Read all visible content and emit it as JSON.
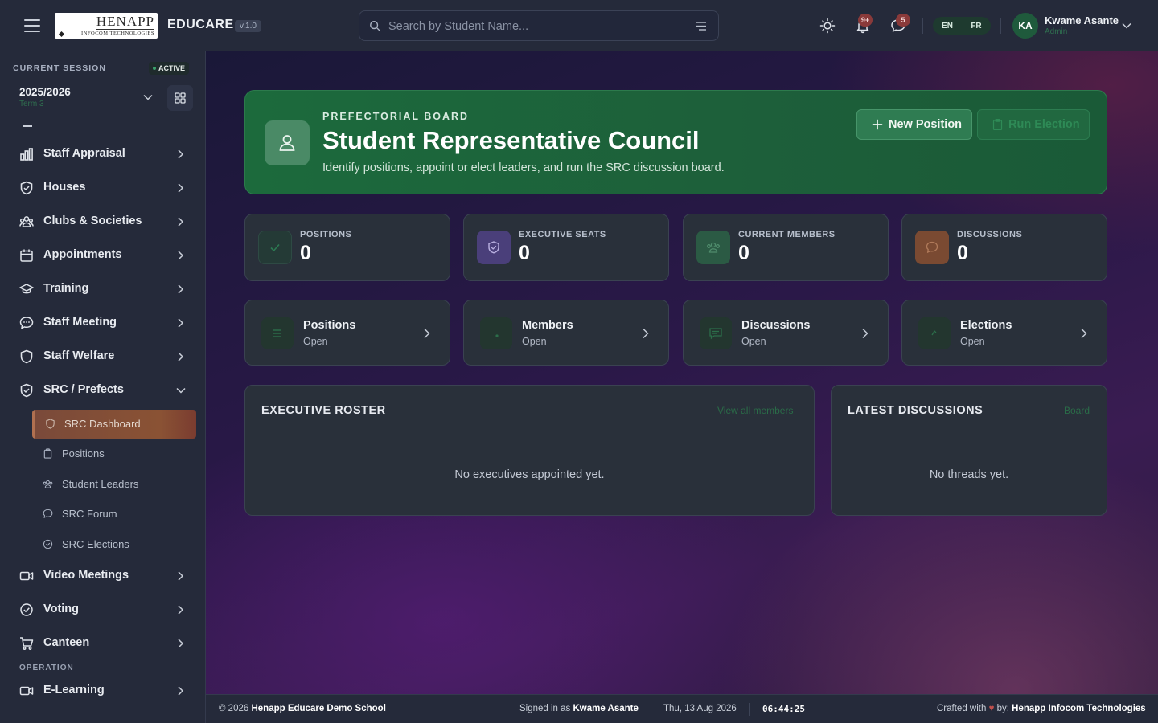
{
  "header": {
    "logo_main": "HENAPP",
    "logo_sub": "INFOCOM TECHNOLOGIES",
    "app_name": "EDUCARE",
    "version": "v.1.0",
    "search_placeholder": "Search by Student Name...",
    "notifications_badge": "9+",
    "messages_badge": "5",
    "lang_en": "EN",
    "lang_fr": "FR",
    "user_initials": "KA",
    "user_name": "Kwame Asante",
    "user_role": "Admin"
  },
  "session": {
    "label": "CURRENT SESSION",
    "status": "ACTIVE",
    "year": "2025/2026",
    "term": "Term 3"
  },
  "sidebar": {
    "items": [
      {
        "label": "Staff Appraisal",
        "icon": "bar-chart-icon"
      },
      {
        "label": "Houses",
        "icon": "shield-icon"
      },
      {
        "label": "Clubs & Societies",
        "icon": "users-icon"
      },
      {
        "label": "Appointments",
        "icon": "calendar-icon"
      },
      {
        "label": "Training",
        "icon": "graduation-cap-icon"
      },
      {
        "label": "Staff Meeting",
        "icon": "chat-bubble-icon"
      },
      {
        "label": "Staff Welfare",
        "icon": "shield-heart-icon"
      },
      {
        "label": "SRC / Prefects",
        "icon": "shield-check-icon"
      }
    ],
    "sub_items": [
      {
        "label": "SRC Dashboard",
        "icon": "shield-icon",
        "active": true
      },
      {
        "label": "Positions",
        "icon": "clipboard-icon"
      },
      {
        "label": "Student Leaders",
        "icon": "users-icon"
      },
      {
        "label": "SRC Forum",
        "icon": "chat-bubble-icon"
      },
      {
        "label": "SRC Elections",
        "icon": "check-circle-icon"
      }
    ],
    "items_after": [
      {
        "label": "Video Meetings",
        "icon": "video-icon"
      },
      {
        "label": "Voting",
        "icon": "check-circle-icon"
      },
      {
        "label": "Canteen",
        "icon": "cart-icon"
      }
    ],
    "section_operation": "OPERATION",
    "items_operation": [
      {
        "label": "E-Learning",
        "icon": "video-icon"
      }
    ]
  },
  "hero": {
    "overline": "PREFECTORIAL BOARD",
    "title": "Student Representative Council",
    "description": "Identify positions, appoint or elect leaders, and run the SRC discussion board.",
    "new_position_label": "New Position",
    "run_election_label": "Run Election"
  },
  "stats": [
    {
      "label": "POSITIONS",
      "value": "0",
      "icon": "check-icon",
      "color": "#243a36"
    },
    {
      "label": "EXECUTIVE SEATS",
      "value": "0",
      "icon": "shield-icon",
      "color": "#4a3f7a"
    },
    {
      "label": "CURRENT MEMBERS",
      "value": "0",
      "icon": "users-icon",
      "color": "#2b5a44"
    },
    {
      "label": "DISCUSSIONS",
      "value": "0",
      "icon": "chat-bubble-icon",
      "color": "#7a4a32"
    }
  ],
  "quick_links": [
    {
      "title": "Positions",
      "subtitle": "Open",
      "icon": "list-icon"
    },
    {
      "title": "Members",
      "subtitle": "Open",
      "icon": "users-icon"
    },
    {
      "title": "Discussions",
      "subtitle": "Open",
      "icon": "message-square-icon"
    },
    {
      "title": "Elections",
      "subtitle": "Open",
      "icon": "ballot-icon"
    }
  ],
  "roster": {
    "title": "EXECUTIVE ROSTER",
    "link": "View all members",
    "empty": "No executives appointed yet."
  },
  "discussions": {
    "title": "LATEST DISCUSSIONS",
    "link": "Board",
    "empty": "No threads yet."
  },
  "footer": {
    "copyright_prefix": "© 2026",
    "school": "Henapp Educare Demo School",
    "signed_in_prefix": "Signed in as",
    "signed_in_user": "Kwame Asante",
    "date": "Thu, 13 Aug 2026",
    "time": "06:44:25",
    "crafted_prefix": "Crafted with",
    "crafted_by": "by:",
    "company": "Henapp Infocom Technologies"
  }
}
